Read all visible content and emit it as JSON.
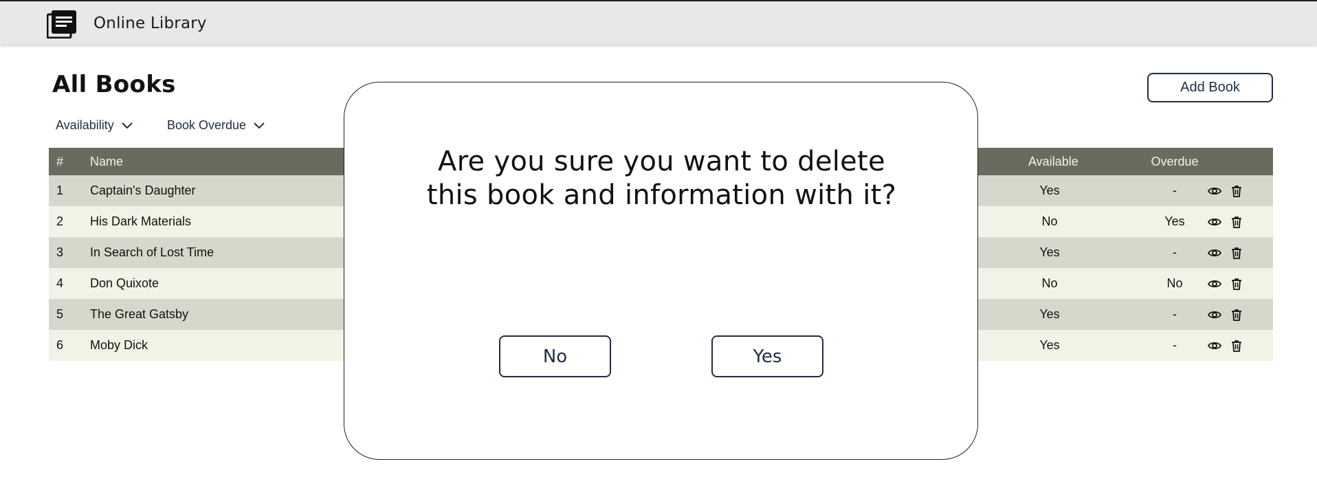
{
  "header": {
    "app_title": "Online Library",
    "logo_icon": "book-stack-icon"
  },
  "page": {
    "title": "All Books",
    "add_book_label": "Add Book"
  },
  "filters": {
    "availability_label": "Availability",
    "overdue_label": "Book Overdue"
  },
  "table": {
    "headers": {
      "num": "#",
      "name": "Name",
      "available": "Available",
      "overdue": "Overdue"
    },
    "rows": [
      {
        "num": "1",
        "name": "Captain's Daughter",
        "available": "Yes",
        "overdue": "-"
      },
      {
        "num": "2",
        "name": "His Dark Materials",
        "available": "No",
        "overdue": "Yes"
      },
      {
        "num": "3",
        "name": "In Search of Lost Time",
        "available": "Yes",
        "overdue": "-"
      },
      {
        "num": "4",
        "name": "Don Quixote",
        "available": "No",
        "overdue": "No"
      },
      {
        "num": "5",
        "name": "The Great Gatsby",
        "available": "Yes",
        "overdue": "-"
      },
      {
        "num": "6",
        "name": "Moby Dick",
        "available": "Yes",
        "overdue": "-"
      }
    ]
  },
  "modal": {
    "line1": "Are you sure you want to delete",
    "line2": "this book and information with it?",
    "no_label": "No",
    "yes_label": "Yes"
  },
  "colors": {
    "header_bg": "#e8e8e8",
    "table_head": "#6b6a5e",
    "row_odd": "#d8d7cc",
    "row_even": "#f2f2e6",
    "accent": "#1d2d44"
  }
}
